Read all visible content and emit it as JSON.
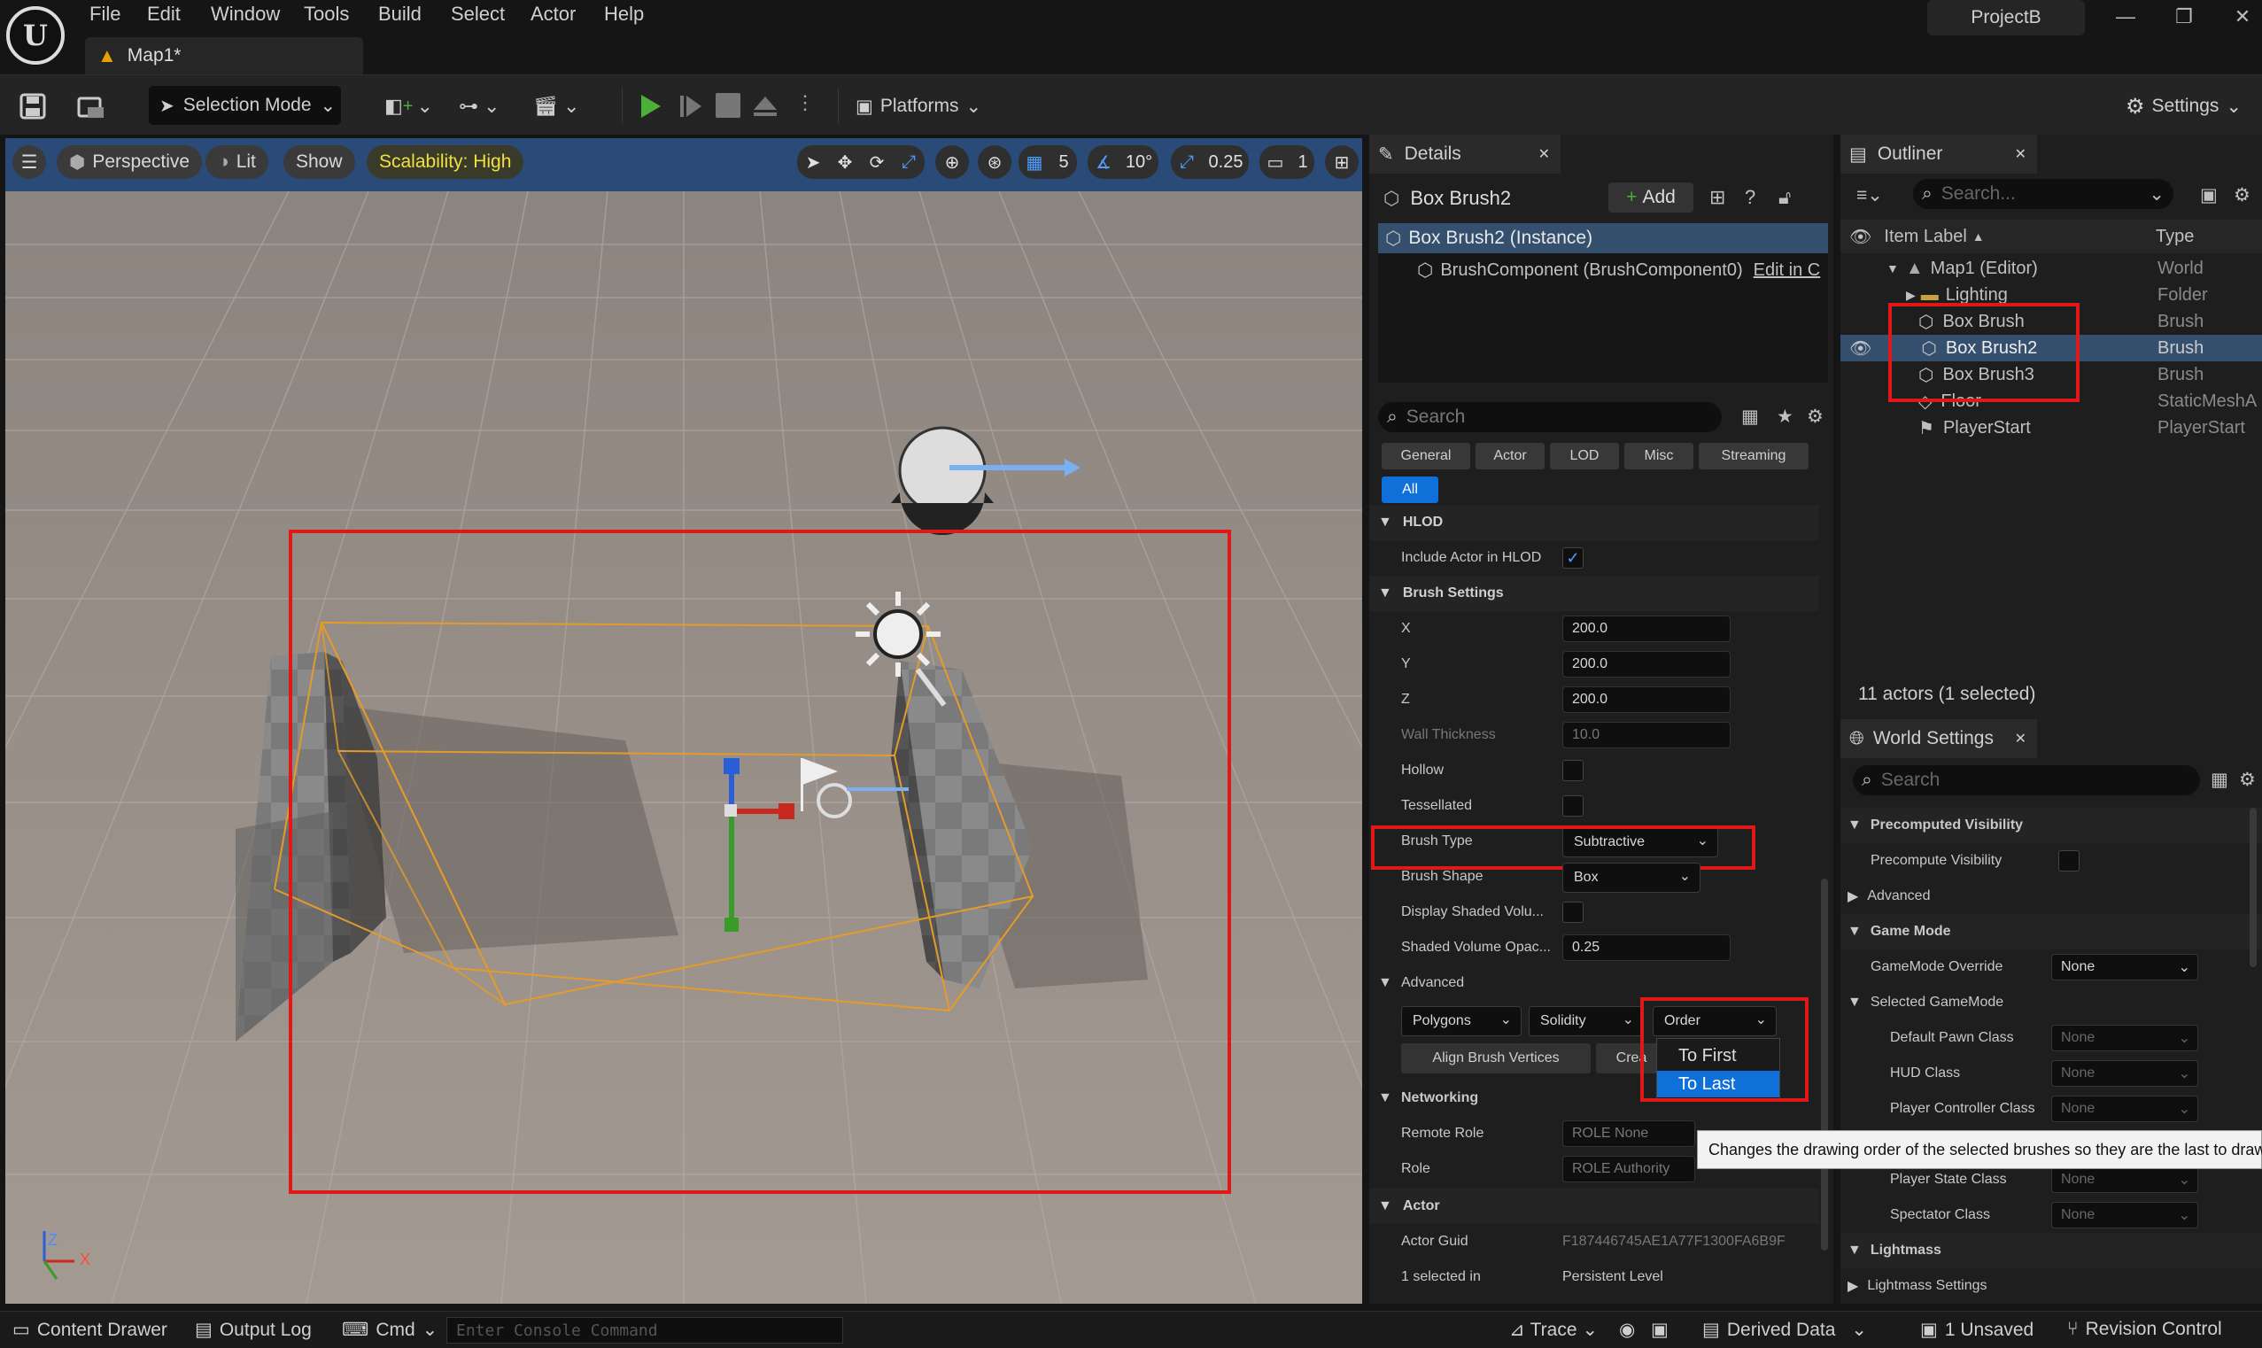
{
  "menubar": {
    "items": [
      "File",
      "Edit",
      "Window",
      "Tools",
      "Build",
      "Select",
      "Actor",
      "Help"
    ],
    "project": "ProjectB",
    "map_tab": "Map1*"
  },
  "toolbar": {
    "selection_mode": "Selection Mode",
    "platforms": "Platforms",
    "settings": "Settings"
  },
  "viewport": {
    "perspective": "Perspective",
    "lit": "Lit",
    "show": "Show",
    "scalability": "Scalability: High",
    "grid_snap": "5",
    "rot_snap": "10°",
    "scale_snap": "0.25",
    "camera_speed": "1",
    "axis_x": "X",
    "axis_z": "Z"
  },
  "details": {
    "tab": "Details",
    "actor_name": "Box Brush2",
    "add_label": "Add",
    "instance": "Box Brush2 (Instance)",
    "component": "BrushComponent (BrushComponent0)",
    "edit_in": "Edit in C",
    "search_placeholder": "Search",
    "filters": [
      "General",
      "Actor",
      "LOD",
      "Misc",
      "Streaming"
    ],
    "filter_all": "All",
    "hlod_section": "HLOD",
    "include_hlod": "Include Actor in HLOD",
    "brush_section": "Brush Settings",
    "x_label": "X",
    "x_value": "200.0",
    "y_label": "Y",
    "y_value": "200.0",
    "z_label": "Z",
    "z_value": "200.0",
    "wall_label": "Wall Thickness",
    "wall_value": "10.0",
    "hollow": "Hollow",
    "tessellated": "Tessellated",
    "brush_type_label": "Brush Type",
    "brush_type_value": "Subtractive",
    "brush_shape_label": "Brush Shape",
    "brush_shape_value": "Box",
    "display_shaded": "Display Shaded Volu...",
    "shaded_opacity_label": "Shaded Volume Opac...",
    "shaded_opacity_value": "0.25",
    "advanced": "Advanced",
    "polygons": "Polygons",
    "solidity": "Solidity",
    "order": "Order",
    "align_vertices": "Align Brush Vertices",
    "create": "Crea",
    "order_options": [
      "To First",
      "To Last"
    ],
    "networking": "Networking",
    "remote_role_label": "Remote Role",
    "remote_role_value": "ROLE None",
    "role_label": "Role",
    "role_value": "ROLE Authority",
    "actor_section": "Actor",
    "actor_guid_label": "Actor Guid",
    "actor_guid_value": "F187446745AE1A77F1300FA6B9F",
    "selected_in_label": "1 selected in",
    "selected_in_value": "Persistent Level",
    "tooltip": "Changes the drawing order of the selected brushes so they are the last to draw"
  },
  "outliner": {
    "tab": "Outliner",
    "search_placeholder": "Search...",
    "col_label": "Item Label",
    "col_type": "Type",
    "rows": [
      {
        "label": "Map1 (Editor)",
        "type": "World"
      },
      {
        "label": "Lighting",
        "type": "Folder"
      },
      {
        "label": "Box Brush",
        "type": "Brush"
      },
      {
        "label": "Box Brush2",
        "type": "Brush"
      },
      {
        "label": "Box Brush3",
        "type": "Brush"
      },
      {
        "label": "Floor",
        "type": "StaticMeshA"
      },
      {
        "label": "PlayerStart",
        "type": "PlayerStart"
      }
    ],
    "count": "11 actors (1 selected)"
  },
  "world_settings": {
    "tab": "World Settings",
    "search_placeholder": "Search",
    "precomputed_visibility": "Precomputed Visibility",
    "precompute_visibility": "Precompute Visibility",
    "advanced": "Advanced",
    "game_mode": "Game Mode",
    "gamemode_override": "GameMode Override",
    "gamemode_override_value": "None",
    "selected_gamemode": "Selected GameMode",
    "default_pawn": "Default Pawn Class",
    "hud_class": "HUD Class",
    "player_controller": "Player Controller Class",
    "player_state": "Player State Class",
    "spectator": "Spectator Class",
    "none": "None",
    "lightmass": "Lightmass",
    "lightmass_settings": "Lightmass Settings"
  },
  "statusbar": {
    "content_drawer": "Content Drawer",
    "output_log": "Output Log",
    "cmd": "Cmd",
    "console_placeholder": "Enter Console Command",
    "trace": "Trace",
    "derived_data": "Derived Data",
    "unsaved": "1 Unsaved",
    "revision_control": "Revision Control"
  },
  "colors": {
    "accent": "#0e70d8",
    "highlight": "#e01818",
    "play": "#4caf3a"
  }
}
